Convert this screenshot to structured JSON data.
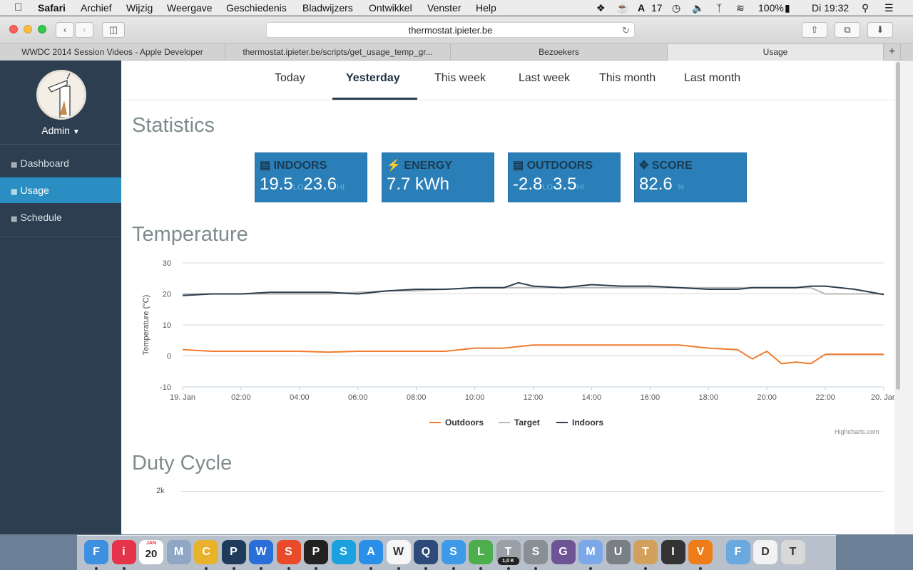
{
  "menubar": {
    "app": "Safari",
    "items": [
      "Archief",
      "Wijzig",
      "Weergave",
      "Geschiedenis",
      "Bladwijzers",
      "Ontwikkel",
      "Venster",
      "Help"
    ],
    "status_number": "17",
    "battery": "100%",
    "clock": "Di 19:32"
  },
  "browser": {
    "url": "thermostat.ipieter.be",
    "tabs": [
      {
        "label": "WWDC 2014 Session Videos - Apple Developer"
      },
      {
        "label": "thermostat.ipieter.be/scripts/get_usage_temp_gr..."
      },
      {
        "label": "Bezoekers"
      },
      {
        "label": "Usage"
      }
    ],
    "new_tab": "+"
  },
  "sidebar": {
    "user": "Admin",
    "items": [
      {
        "label": "Dashboard",
        "icon": "grid-icon"
      },
      {
        "label": "Usage",
        "icon": "bar-chart-icon"
      },
      {
        "label": "Schedule",
        "icon": "calendar-icon"
      }
    ]
  },
  "periods": [
    "Today",
    "Yesterday",
    "This week",
    "Last week",
    "This month",
    "Last month"
  ],
  "active_period": "Yesterday",
  "statistics": {
    "title": "Statistics",
    "cards": [
      {
        "label": "INDOORS",
        "icon": "server-icon",
        "lo": "19.5",
        "lo_unit": "LO",
        "hi": "23.6",
        "hi_unit": "HI"
      },
      {
        "label": "ENERGY",
        "icon": "bolt-icon",
        "value": "7.7 kWh"
      },
      {
        "label": "OUTDOORS",
        "icon": "server-icon",
        "lo": "-2.8",
        "lo_unit": "LO",
        "hi": "3.5",
        "hi_unit": "HI"
      },
      {
        "label": "SCORE",
        "icon": "crosshair-icon",
        "value": "82.6",
        "unit": "%"
      }
    ]
  },
  "temperature_section": {
    "title": "Temperature",
    "credit": "Highcharts.com"
  },
  "duty_section": {
    "title": "Duty Cycle",
    "first_tick": "2k"
  },
  "colors": {
    "outdoors": "#f07c2e",
    "target": "#b8b8b8",
    "indoors": "#2c3e50",
    "accent": "#2a7fb8",
    "sidebar": "#2c3e50"
  },
  "chart_data": {
    "type": "line",
    "title": "",
    "xlabel": "",
    "ylabel": "Temperature (°C)",
    "ylim": [
      -10,
      30
    ],
    "yticks": [
      "30",
      "20",
      "10",
      "0",
      "-10"
    ],
    "xticks": [
      "19. Jan",
      "02:00",
      "04:00",
      "06:00",
      "08:00",
      "10:00",
      "12:00",
      "14:00",
      "16:00",
      "18:00",
      "20:00",
      "22:00",
      "20. Jan"
    ],
    "x": [
      0,
      1,
      2,
      3,
      4,
      5,
      6,
      7,
      8,
      9,
      10,
      11,
      11.5,
      12,
      13,
      14,
      15,
      16,
      17,
      18,
      19,
      19.5,
      20,
      20.5,
      21,
      21.5,
      22,
      23,
      24
    ],
    "series": [
      {
        "name": "Outdoors",
        "values": [
          2.0,
          1.5,
          1.5,
          1.5,
          1.5,
          1.2,
          1.5,
          1.5,
          1.5,
          1.5,
          2.5,
          2.5,
          3.0,
          3.5,
          3.5,
          3.5,
          3.5,
          3.5,
          3.5,
          2.5,
          2.0,
          -1.0,
          1.5,
          -2.5,
          -2.0,
          -2.5,
          0.5,
          0.5,
          0.5
        ]
      },
      {
        "name": "Target",
        "values": [
          20,
          20,
          20,
          20,
          20,
          20,
          20.5,
          21,
          21,
          21.5,
          22,
          22,
          22,
          22,
          22,
          22,
          22,
          22,
          22,
          22,
          22,
          22,
          22,
          22,
          22,
          22,
          20,
          20,
          20
        ]
      },
      {
        "name": "Indoors",
        "values": [
          19.5,
          20,
          20,
          20.5,
          20.5,
          20.5,
          20,
          21,
          21.5,
          21.5,
          22,
          22,
          23.6,
          22.5,
          22,
          23,
          22.5,
          22.5,
          22,
          21.5,
          21.5,
          22,
          22,
          22,
          22,
          22.5,
          22.5,
          21.5,
          19.8
        ]
      }
    ],
    "legend": "bottom-center",
    "grid": true
  },
  "dock": [
    "Finder",
    "iTunes",
    "Calendar",
    "Mail",
    "Chrome",
    "Photoshop",
    "WebStorm",
    "Sketch",
    "Plex",
    "Skype",
    "App Store",
    "Writer",
    "QuickTime",
    "Safari",
    "Leaf",
    "Transmit",
    "System Prefs",
    "GitHub",
    "Messages",
    "Utilities",
    "Transmit",
    "Instruments",
    "VLC",
    "Folder",
    "Documents",
    "Trash"
  ],
  "dock_badge": "1,0 K",
  "calendar_day": "20",
  "calendar_month": "JAN"
}
